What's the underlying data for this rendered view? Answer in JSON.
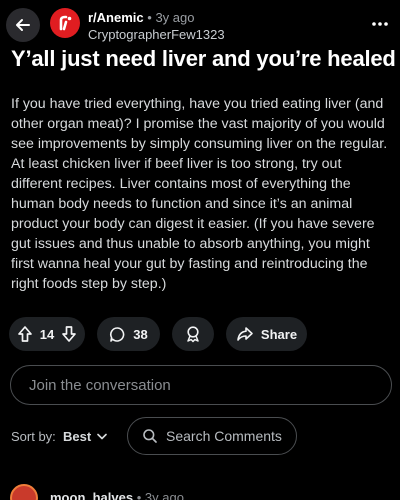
{
  "header": {
    "back_icon": "arrow-left-icon",
    "subreddit_icon": "reddit-r-logo",
    "subreddit": "r/Anemic",
    "separator": "•",
    "age": "3y ago",
    "author": "CryptographerFew1323",
    "more_icon": "more-horizontal-icon"
  },
  "post": {
    "title": "Y’all just need liver and you’re healed",
    "body": "If you have tried everything, have you tried eating liver (and other organ meat)? I promise the vast majority of you would see improvements by simply consuming liver on the regular. At least chicken liver if beef liver is too strong, try out different recipes. Liver contains most of everything the human body needs to function and since it’s an animal product your body can digest it easier. (If you have severe gut issues and thus unable to absorb anything, you might first wanna heal your gut by fasting and reintroducing the right foods step by step.)"
  },
  "actions": {
    "vote_count": "14",
    "comment_count": "38",
    "share_label": "Share"
  },
  "reply": {
    "placeholder": "Join the conversation"
  },
  "sort": {
    "label": "Sort by:",
    "value": "Best",
    "search_placeholder": "Search Comments"
  },
  "first_comment": {
    "username": "moon_halves",
    "separator": "•",
    "age": "3y ago"
  },
  "colors": {
    "background": "#000000",
    "pill": "#1e2124",
    "subreddit_red": "#e01d21"
  }
}
